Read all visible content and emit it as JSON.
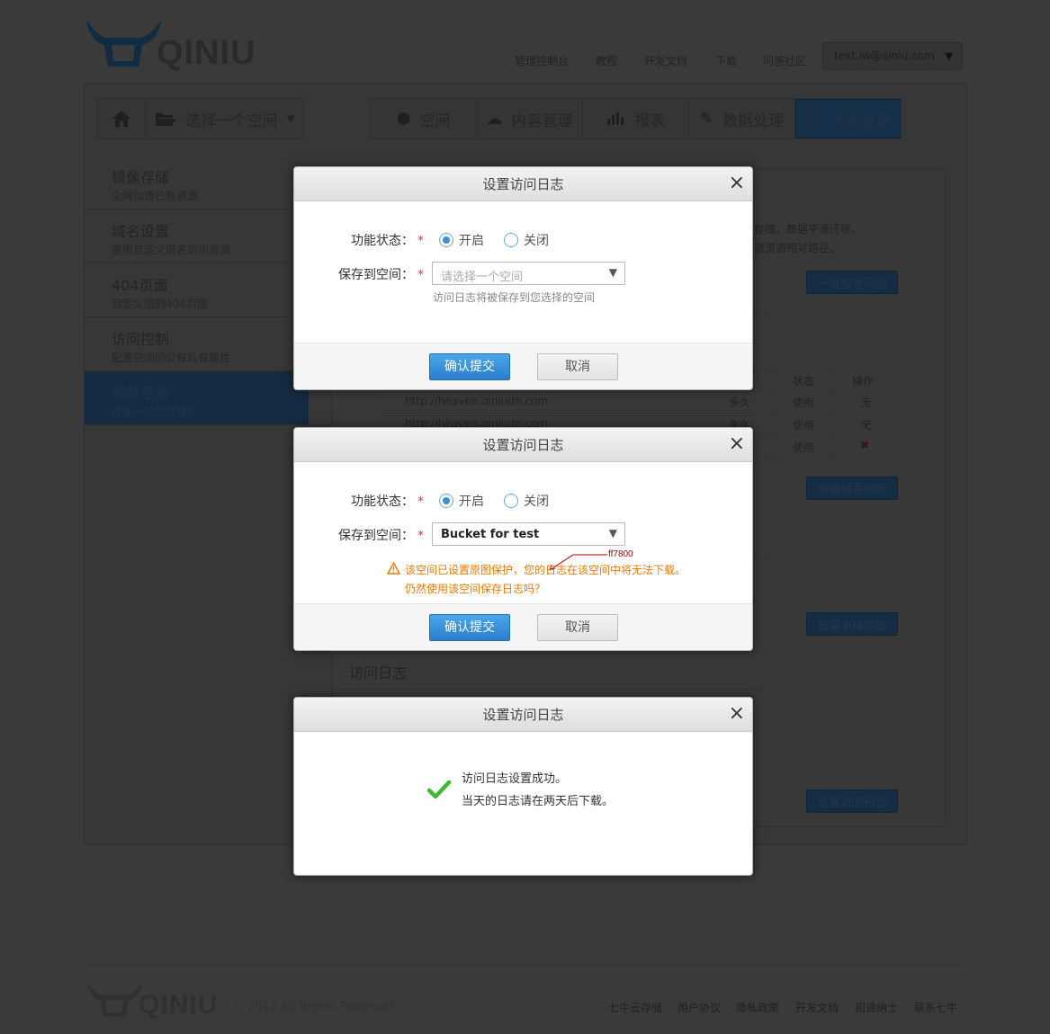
{
  "header": {
    "logo_text": "QINIU",
    "nav": [
      "管理控制台",
      "教程",
      "开发文档",
      "下载",
      "问答社区"
    ],
    "user_email": "text.lw@qiniu.com"
  },
  "toolbar": {
    "bucket_select_label": "选择一个空间",
    "tabs": [
      {
        "label": "空间",
        "icon": "box-icon"
      },
      {
        "label": "内容管理",
        "icon": "cloud-upload-icon"
      },
      {
        "label": "报表",
        "icon": "bar-chart-icon"
      },
      {
        "label": "数据处理",
        "icon": "pencil-icon"
      },
      {
        "label": "空间设置",
        "icon": "gears-icon",
        "active": true
      }
    ]
  },
  "sidebar": {
    "items": [
      {
        "title": "镜像存储",
        "subtitle": "全网加速已有资源"
      },
      {
        "title": "域名设置",
        "subtitle": "使用自定义域名访问资源"
      },
      {
        "title": "404页面",
        "subtitle": "自定义您的404页面"
      },
      {
        "title": "访问控制",
        "subtitle": "配置空间的公有私有属性"
      },
      {
        "title": "删除空间",
        "subtitle": "这是一个危险操作",
        "active": true
      }
    ]
  },
  "content": {
    "mirror_desc_1": "存储，数据平滑迁移。",
    "mirror_desc_2": "源资源相对路径。",
    "mirror_button": "一键加速网站",
    "domain_table": {
      "headers": [
        "状态",
        "操作"
      ],
      "rows": [
        {
          "domain": "http://heaven.qiniudn.com",
          "type": "永久",
          "status": "使用",
          "action": "无"
        },
        {
          "domain": "http://heaven.qiniudn.com",
          "type": "永久",
          "status": "使用",
          "action": "无"
        },
        {
          "domain": "",
          "type": "",
          "status": "使用",
          "action": "✖"
        }
      ]
    },
    "domain_button": "申请域名绑定",
    "page404_button": "设置404页面",
    "access_log_title": "访问日志",
    "access_log_button": "设置访问日志"
  },
  "dialogs": {
    "title": "设置访问日志",
    "close": "×",
    "status_label": "功能状态：",
    "save_label": "保存到空间：",
    "required_mark": "*",
    "radio_on": "开启",
    "radio_off": "关闭",
    "select_placeholder": "请选择一个空间",
    "select_hint": "访问日志将被保存到您选择的空间",
    "selected_bucket": "Bucket for test",
    "color_annotation": "ff7800",
    "warning_line_1": "该空间已设置原图保护，您的日志在该空间中将无法下载。",
    "warning_line_2": "仍然使用该空间保存日志吗？",
    "confirm_button": "确认提交",
    "cancel_button": "取消",
    "success_line_1": "访问日志设置成功。",
    "success_line_2": "当天的日志请在两天后下载。"
  },
  "footer": {
    "logo_text": "QINIU",
    "copyright": "© 2012  All Rights Reserved",
    "links": [
      "七牛云存储",
      "用户协议",
      "隐私政策",
      "开发文档",
      "招贤纳士",
      "联系七牛"
    ]
  },
  "colors": {
    "accent_blue": "#2a7fcc",
    "warning_orange": "#ff7800",
    "success_green": "#3dbb2f",
    "required_red": "#e33333"
  }
}
